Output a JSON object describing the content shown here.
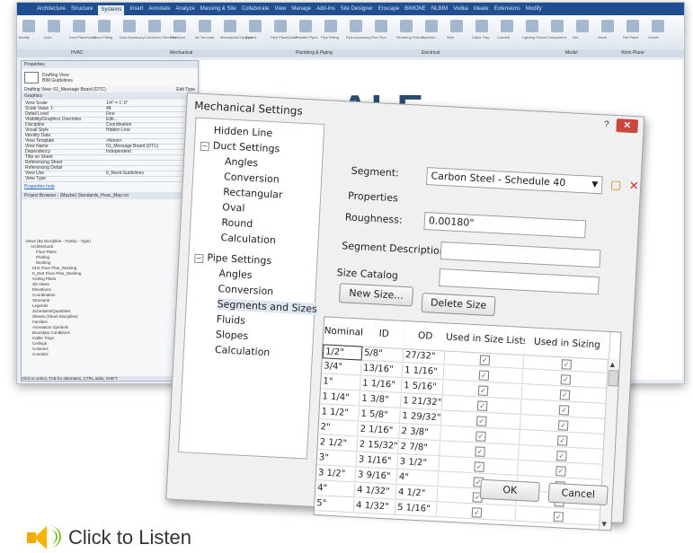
{
  "background_app": {
    "logo": "R",
    "tabs": [
      "Architecture",
      "Structure",
      "Systems",
      "Insert",
      "Annotate",
      "Analyze",
      "Massing & Site",
      "Collaborate",
      "View",
      "Manage",
      "Add-Ins",
      "Site Designer",
      "Enscape",
      "BIMONE",
      "NLBIM",
      "Vodka",
      "Ideate",
      "Extensions",
      "Modify"
    ],
    "active_tab": "Systems",
    "ribbon_groups": [
      "HVAC",
      "Mechanical",
      "Plumbing & Piping",
      "Electrical",
      "Model",
      "Work Plane"
    ],
    "ribbon_labels": [
      "Modify",
      "Duct",
      "Duct Placeholder",
      "Duct Fitting",
      "Duct Accessory",
      "Convert to Flex Duct",
      "Flex Duct",
      "Air Terminal",
      "Mechanical Equipment",
      "Pipe",
      "Pipe Placeholder",
      "Parallel Pipes",
      "Pipe Fitting",
      "Pipe Accessory",
      "Flex Pipe",
      "Plumbing Fixture",
      "Sprinkler",
      "Wire",
      "Cable Tray",
      "Conduit",
      "Lighting Fixture",
      "Component",
      "Set",
      "Show",
      "Ref Plane",
      "Viewer"
    ],
    "properties_title": "Properties",
    "view_type": "Drafting View",
    "view_subtype": "BIM Guidelines",
    "view_selector": "Drafting View: 01_Message Board (DTC)",
    "edit_type": "Edit Type",
    "graphics_header": "Graphics",
    "properties_rows": [
      [
        "View Scale",
        "1/4\" = 1'-0\""
      ],
      [
        "Scale Value 1:",
        "48"
      ],
      [
        "Detail Level",
        "Fine"
      ],
      [
        "Visibility/Graphics Overrides",
        "Edit..."
      ],
      [
        "Discipline",
        "Coordination"
      ],
      [
        "Visual Style",
        "Hidden Line"
      ],
      [
        "Identity Data",
        ""
      ],
      [
        "View Template",
        "<None>"
      ],
      [
        "View Name",
        "01_Message Board (DTC)"
      ],
      [
        "Dependency",
        "Independent"
      ],
      [
        "Title on Sheet",
        ""
      ],
      [
        "Referencing Sheet",
        ""
      ],
      [
        "Referencing Detail",
        ""
      ],
      [
        "View Use",
        "0_Revit Guidelines"
      ],
      [
        "View Type",
        ""
      ]
    ],
    "properties_help": "Properties help",
    "browser_title": "Project Browser - (Maybe) Standards_Hvac_Mep.rvt",
    "browser_items": [
      "Views (By Discipline - Family - Type)",
      "Architectural",
      "Floor Plans",
      "Plotting",
      "Working",
      "01st Floor Plan_Working",
      "0_01st Floor Plan_Working",
      "Ceiling Plans",
      "3D Views",
      "Elevations",
      "Coordination",
      "Structural",
      "Legends",
      "Schedules/Quantities",
      "Sheets (Sheet Discipline)",
      "Families",
      "Annotation Symbols",
      "Boundary Conditions",
      "Cable Trays",
      "Ceilings",
      "Columns",
      "Conduits"
    ],
    "status_bar": "Click to select, TAB for alternates, CTRL adds, SHIFT",
    "logo_text": "ALE"
  },
  "dialog": {
    "title": "Mechanical Settings",
    "help_glyph": "?",
    "close_glyph": "✕",
    "tree": [
      {
        "label": "Hidden Line",
        "level": 0
      },
      {
        "label": "Duct Settings",
        "level": 0,
        "toggle": "−"
      },
      {
        "label": "Angles",
        "level": 1
      },
      {
        "label": "Conversion",
        "level": 1
      },
      {
        "label": "Rectangular",
        "level": 1
      },
      {
        "label": "Oval",
        "level": 1
      },
      {
        "label": "Round",
        "level": 1
      },
      {
        "label": "Calculation",
        "level": 1
      },
      {
        "label": "Pipe Settings",
        "level": 0,
        "toggle": "−"
      },
      {
        "label": "Angles",
        "level": 1
      },
      {
        "label": "Conversion",
        "level": 1
      },
      {
        "label": "Segments and Sizes",
        "level": 1,
        "selected": true
      },
      {
        "label": "Fluids",
        "level": 1
      },
      {
        "label": "Slopes",
        "level": 1
      },
      {
        "label": "Calculation",
        "level": 1
      }
    ],
    "segment_label": "Segment:",
    "segment_value": "Carbon Steel - Schedule 40",
    "properties_label": "Properties",
    "roughness_label": "Roughness:",
    "roughness_value": "0.00180\"",
    "segment_desc_label": "Segment Description:",
    "segment_desc_value": "",
    "size_catalog_label": "Size Catalog",
    "new_size_button": "New Size...",
    "delete_size_button": "Delete Size",
    "columns": [
      "Nominal",
      "ID",
      "OD",
      "Used in Size Lists",
      "Used in Sizing"
    ],
    "rows": [
      {
        "nominal": "1/2\"",
        "id": "5/8\"",
        "od": "27/32\""
      },
      {
        "nominal": "3/4\"",
        "id": "13/16\"",
        "od": "1 1/16\""
      },
      {
        "nominal": "1\"",
        "id": "1 1/16\"",
        "od": "1 5/16\""
      },
      {
        "nominal": "1 1/4\"",
        "id": "1 3/8\"",
        "od": "1 21/32\""
      },
      {
        "nominal": "1 1/2\"",
        "id": "1 5/8\"",
        "od": "1 29/32\""
      },
      {
        "nominal": "2\"",
        "id": "2 1/16\"",
        "od": "2 3/8\""
      },
      {
        "nominal": "2 1/2\"",
        "id": "2 15/32\"",
        "od": "2 7/8\""
      },
      {
        "nominal": "3\"",
        "id": "3 1/16\"",
        "od": "3 1/2\""
      },
      {
        "nominal": "3 1/2\"",
        "id": "3 9/16\"",
        "od": "4\""
      },
      {
        "nominal": "4\"",
        "id": "4 1/32\"",
        "od": "4 1/2\""
      },
      {
        "nominal": "5\"",
        "id": "4 1/32\"",
        "od": "5 1/16\""
      }
    ],
    "check_glyph": "✓",
    "ok_button": "OK",
    "cancel_button": "Cancel"
  },
  "listen": {
    "text": "Click to Listen",
    "icon": "speaker-icon",
    "colors": {
      "speaker": "#f2a900",
      "waves": "#7bbf2a"
    }
  }
}
